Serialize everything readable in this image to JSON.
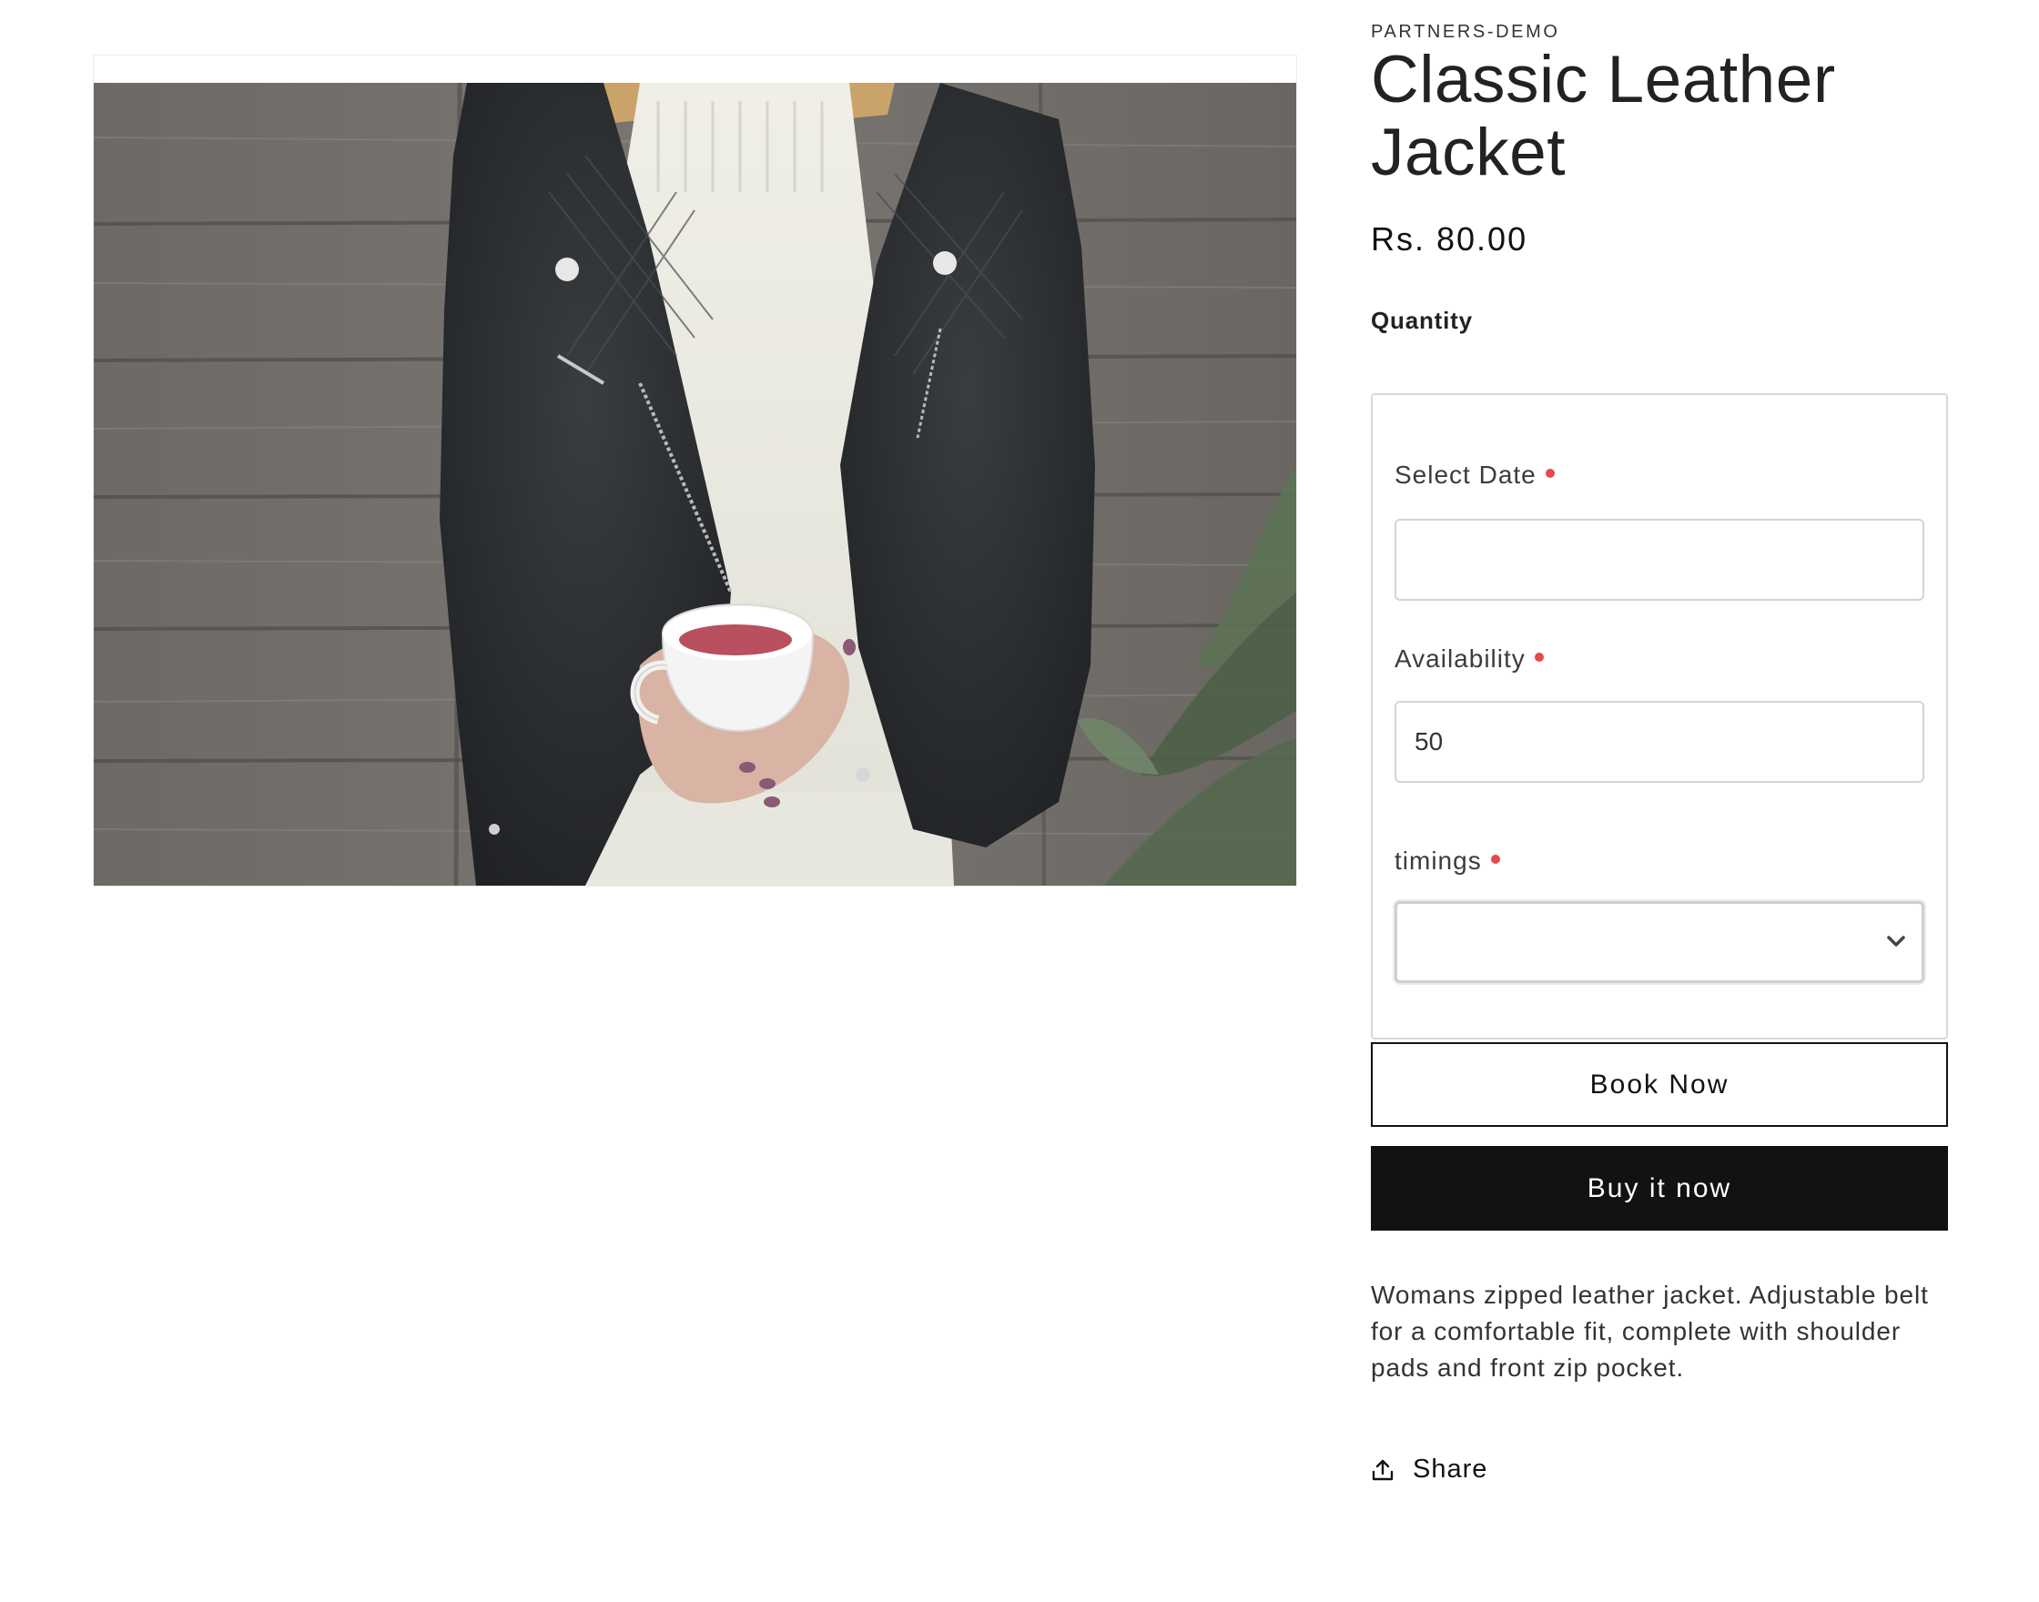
{
  "product": {
    "vendor": "PARTNERS-DEMO",
    "title": "Classic Leather Jacket",
    "price": "Rs. 80.00",
    "quantity_label": "Quantity",
    "description": "Womans zipped leather jacket. Adjustable belt for a comfortable fit, complete with shoulder pads and front zip pocket."
  },
  "booking": {
    "date_label": "Select Date",
    "date_value": "",
    "availability_label": "Availability",
    "availability_value": "50",
    "timings_label": "timings",
    "timings_value": "",
    "required_color": "#e5484d"
  },
  "actions": {
    "book_now": "Book Now",
    "buy_now": "Buy it now",
    "share": "Share"
  },
  "icons": {
    "share": "share-icon",
    "select_arrow": "chevron-down-icon"
  },
  "colors": {
    "primary": "#121212",
    "text": "#333333",
    "border": "#d9d9d9"
  }
}
